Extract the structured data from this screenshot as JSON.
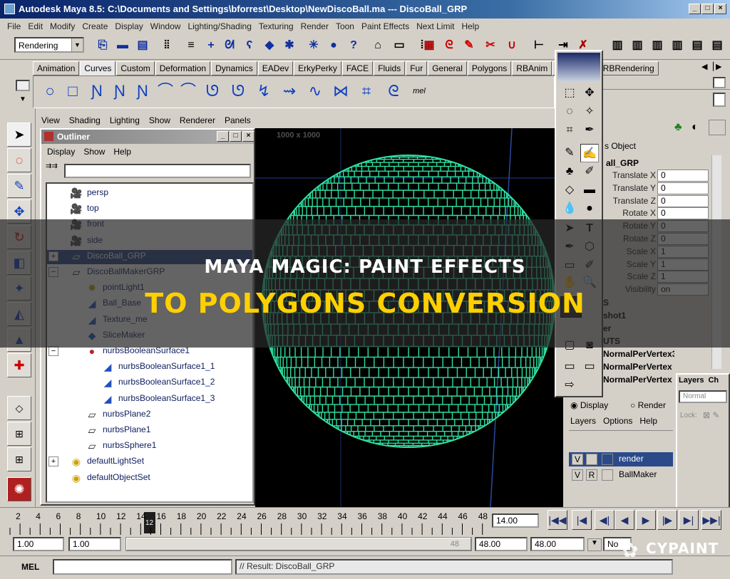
{
  "window": {
    "title": "Autodesk Maya 8.5: C:\\Documents and Settings\\bforrest\\Desktop\\NewDiscoBall.ma  ---  DiscoBall_GRP"
  },
  "menu": [
    "File",
    "Edit",
    "Modify",
    "Create",
    "Display",
    "Window",
    "Lighting/Shading",
    "Texturing",
    "Render",
    "Toon",
    "Paint Effects",
    "Next Limit",
    "Help"
  ],
  "status_line": {
    "mode": "Rendering"
  },
  "shelf_tabs": [
    "Animation",
    "Curves",
    "Custom",
    "Deformation",
    "Dynamics",
    "EADev",
    "ErkyPerky",
    "FACE",
    "Fluids",
    "Fur",
    "General",
    "Polygons",
    "RBAnim",
    "Modelling",
    "RBRendering"
  ],
  "shelf_active": "Curves",
  "shelf_mel": "mel",
  "panel_menu": [
    "View",
    "Shading",
    "Lighting",
    "Show",
    "Renderer",
    "Panels"
  ],
  "viewport": {
    "resolution_label": "1000 x 1000"
  },
  "outliner": {
    "title": "Outliner",
    "menu": [
      "Display",
      "Show",
      "Help"
    ],
    "items": [
      {
        "label": "persp",
        "icon": "camera-icon",
        "indent": 0,
        "expand": ""
      },
      {
        "label": "top",
        "icon": "camera-icon",
        "indent": 0,
        "expand": ""
      },
      {
        "label": "front",
        "icon": "camera-icon",
        "indent": 0,
        "expand": ""
      },
      {
        "label": "side",
        "icon": "camera-icon",
        "indent": 0,
        "expand": ""
      },
      {
        "label": "DiscoBall_GRP",
        "icon": "group-icon",
        "indent": 0,
        "expand": "+",
        "selected": true
      },
      {
        "label": "DiscoBallMakerGRP",
        "icon": "group-icon",
        "indent": 0,
        "expand": "−"
      },
      {
        "label": "pointLight1",
        "icon": "light-icon",
        "indent": 1,
        "expand": ""
      },
      {
        "label": "Ball_Base",
        "icon": "surface-icon",
        "indent": 1,
        "expand": ""
      },
      {
        "label": "Texture_me",
        "icon": "surface-icon",
        "indent": 1,
        "expand": ""
      },
      {
        "label": "SliceMaker",
        "icon": "mesh-icon",
        "indent": 1,
        "expand": ""
      },
      {
        "label": "nurbsBooleanSurface1",
        "icon": "boolean-icon",
        "indent": 1,
        "expand": "−"
      },
      {
        "label": "nurbsBooleanSurface1_1",
        "icon": "surface-icon",
        "indent": 2,
        "expand": ""
      },
      {
        "label": "nurbsBooleanSurface1_2",
        "icon": "surface-icon",
        "indent": 2,
        "expand": ""
      },
      {
        "label": "nurbsBooleanSurface1_3",
        "icon": "surface-icon",
        "indent": 2,
        "expand": ""
      },
      {
        "label": "nurbsPlane2",
        "icon": "plane-icon",
        "indent": 1,
        "expand": ""
      },
      {
        "label": "nurbsPlane1",
        "icon": "plane-icon",
        "indent": 1,
        "expand": ""
      },
      {
        "label": "nurbsSphere1",
        "icon": "plane-icon",
        "indent": 1,
        "expand": ""
      },
      {
        "label": "defaultLightSet",
        "icon": "set-icon",
        "indent": 0,
        "expand": "+"
      },
      {
        "label": "defaultObjectSet",
        "icon": "set-icon",
        "indent": 0,
        "expand": ""
      }
    ]
  },
  "channel_box": {
    "tabs_label": "s  Object",
    "object": "all_GRP",
    "attributes": [
      {
        "name": "Translate X",
        "value": "0"
      },
      {
        "name": "Translate Y",
        "value": "0"
      },
      {
        "name": "Translate Z",
        "value": "0"
      },
      {
        "name": "Rotate X",
        "value": "0"
      },
      {
        "name": "Rotate Y",
        "value": "0"
      },
      {
        "name": "Rotate Z",
        "value": "0"
      },
      {
        "name": "Scale X",
        "value": "1"
      },
      {
        "name": "Scale Y",
        "value": "1"
      },
      {
        "name": "Scale Z",
        "value": "1"
      },
      {
        "name": "Visibility",
        "value": "on"
      }
    ],
    "sections": [
      "S",
      "shot1",
      "er",
      "UTS",
      "NormalPerVertex3",
      "NormalPerVertex",
      "NormalPerVertex"
    ]
  },
  "layer_panel": {
    "display_label": "Display",
    "render_label": "Render",
    "menu": [
      "Layers",
      "Options",
      "Help"
    ],
    "layers": [
      {
        "v": "V",
        "r": "",
        "name": "render",
        "selected": true
      },
      {
        "v": "V",
        "r": "R",
        "name": "BallMaker",
        "selected": false
      }
    ]
  },
  "layer_window": {
    "tabs": [
      "Layers",
      "Ch"
    ],
    "mode": "Normal",
    "lock": "Lock:"
  },
  "timeline": {
    "ticks": [
      "2",
      "4",
      "6",
      "8",
      "10",
      "12",
      "14",
      "16",
      "18",
      "20",
      "22",
      "24",
      "26",
      "28",
      "30",
      "32",
      "34",
      "36",
      "38",
      "40",
      "42",
      "44",
      "46",
      "48"
    ],
    "current": "14.00",
    "current_tick": "12"
  },
  "range": {
    "start": "1.00",
    "start2": "1.00",
    "slider_label": "48",
    "end": "48.00",
    "end2": "48.00",
    "char_set": "No"
  },
  "command_line": {
    "label": "MEL",
    "result": "// Result: DiscoBall_GRP"
  },
  "overlay": {
    "line1": "MAYA MAGIC: PAINT EFFECTS",
    "line2": "TO POLYGONS CONVERSION"
  },
  "watermark": {
    "brand": "CYPAINT"
  },
  "colors": {
    "wireframe": "#2fe0a0",
    "selection": "#2a4a8a",
    "accent": "#ffd000"
  }
}
